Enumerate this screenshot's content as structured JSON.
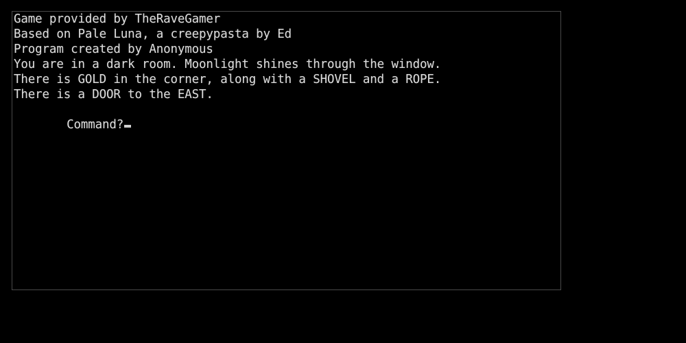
{
  "window": {
    "background_color": "#000000",
    "console_background_color": "#000000",
    "console_border_color": "#4a4a4a",
    "text_color": "#dcdcdc"
  },
  "console": {
    "lines": [
      "Game provided by TheRaveGamer",
      "Based on Pale Luna, a creepypasta by Ed",
      "Program created by Anonymous",
      "You are in a dark room. Moonlight shines through the window.",
      "There is GOLD in the corner, along with a SHOVEL and a ROPE.",
      "There is a DOOR to the EAST."
    ],
    "prompt": {
      "label": "Command?",
      "value": "",
      "cursor": "_"
    }
  }
}
